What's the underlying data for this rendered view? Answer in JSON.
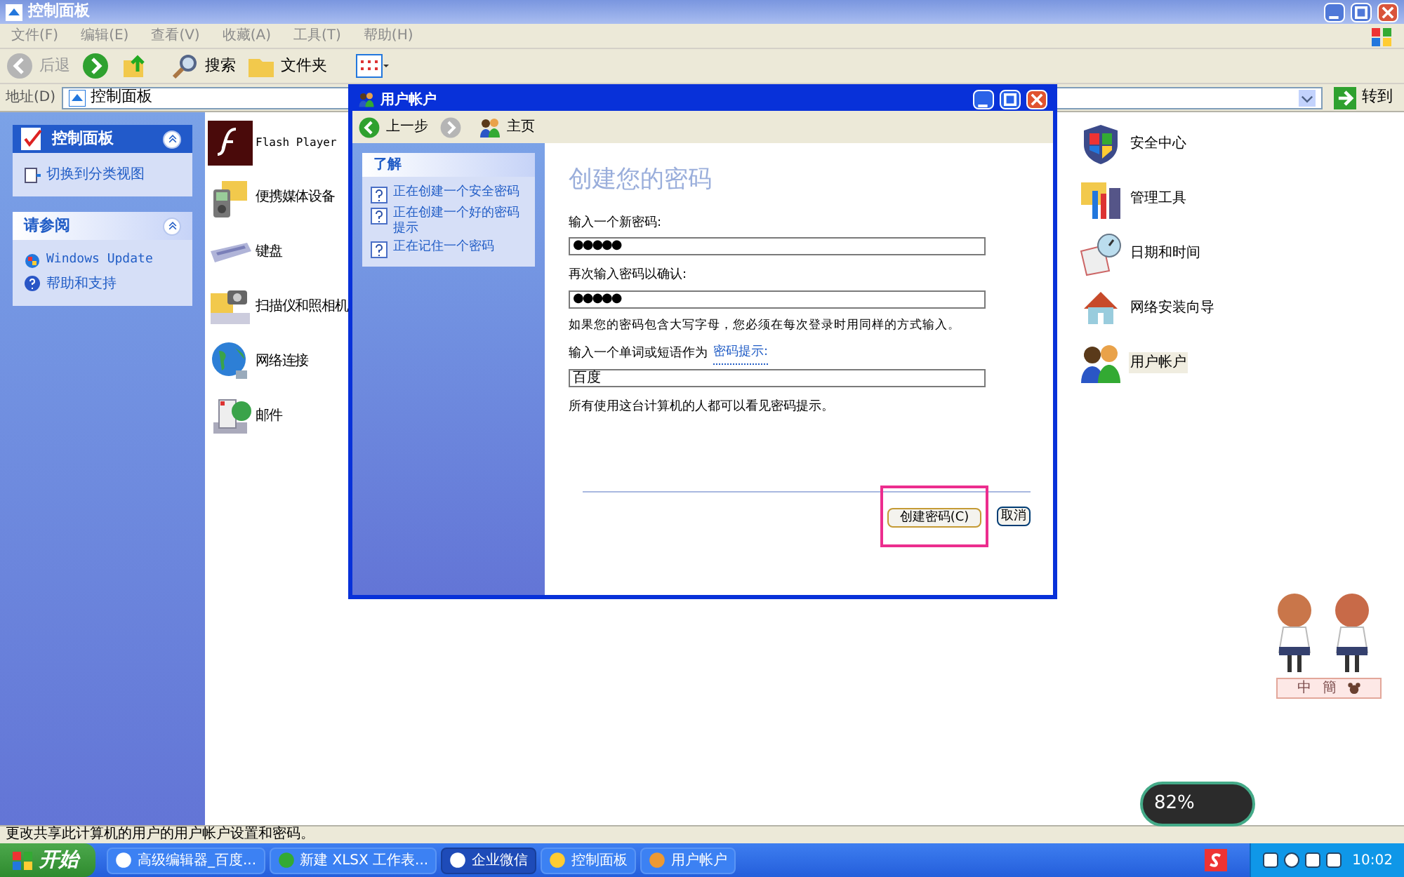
{
  "window": {
    "title": "控制面板"
  },
  "menu": [
    "文件(F)",
    "编辑(E)",
    "查看(V)",
    "收藏(A)",
    "工具(T)",
    "帮助(H)"
  ],
  "toolbar": {
    "back": "后退",
    "search": "搜索",
    "folders": "文件夹"
  },
  "address": {
    "label": "地址(D)",
    "value": "控制面板",
    "go": "转到"
  },
  "sidebar": [
    {
      "title": "控制面板",
      "links": [
        "切换到分类视图"
      ]
    },
    {
      "title": "请参阅",
      "links": [
        "Windows Update",
        "帮助和支持"
      ]
    }
  ],
  "items_left": [
    "Flash Player",
    "便携媒体设备",
    "键盘",
    "扫描仪和照相机",
    "网络连接",
    "邮件"
  ],
  "items_right": [
    {
      "label": "安全中心",
      "selected": false
    },
    {
      "label": "管理工具",
      "selected": false
    },
    {
      "label": "日期和时间",
      "selected": false
    },
    {
      "label": "网络安装向导",
      "selected": false
    },
    {
      "label": "用户帐户",
      "selected": true
    }
  ],
  "dialog": {
    "title": "用户帐户",
    "back": "上一步",
    "home": "主页",
    "learn": {
      "title": "了解",
      "links": [
        "正在创建一个安全密码",
        "正在创建一个好的密码提示",
        "正在记住一个密码"
      ]
    },
    "heading": "创建您的密码",
    "new_label": "输入一个新密码:",
    "new_value": "●●●●●",
    "confirm_label": "再次输入密码以确认:",
    "confirm_value": "●●●●●",
    "caps_note": "如果您的密码包含大写字母，您必须在每次登录时用同样的方式输入。",
    "hint_label": "输入一个单词或短语作为",
    "hint_link": "密码提示:",
    "hint_value": "百度",
    "hint_note": "所有使用这台计算机的人都可以看见密码提示。",
    "create": {
      "label": "创建密码(C)",
      "highlighted": true
    },
    "cancel": "取消"
  },
  "status_bar": "更改共享此计算机的用户的用户帐户设置和密码。",
  "language_bar": [
    "中",
    "簡"
  ],
  "speed_widget": "82%",
  "taskbar": {
    "start": "开始",
    "tasks": [
      {
        "label": "高级编辑器_百度...",
        "selected": false
      },
      {
        "label": "新建 XLSX 工作表...",
        "selected": false
      },
      {
        "label": "企业微信",
        "selected": true
      },
      {
        "label": "控制面板",
        "selected": false
      },
      {
        "label": "用户帐户",
        "selected": false
      }
    ],
    "time": "10:02"
  }
}
